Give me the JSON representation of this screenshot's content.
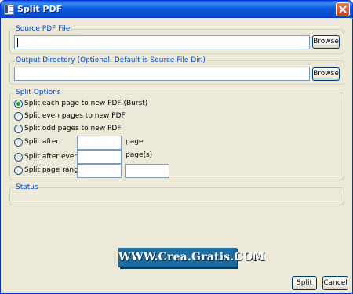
{
  "window": {
    "title": "Split PDF"
  },
  "source": {
    "label": "Source PDF File",
    "value": "",
    "browse_label": "Browse"
  },
  "output": {
    "label": "Output Directory (Optional. Default is Source File Dir.)",
    "value": "",
    "browse_label": "Browse"
  },
  "split_options": {
    "label": "Split Options",
    "selected": "burst",
    "options": [
      {
        "id": "burst",
        "label": "Split each page to new PDF (Burst)"
      },
      {
        "id": "even",
        "label": "Split even pages to new PDF"
      },
      {
        "id": "odd",
        "label": "Split odd pages to new PDF"
      },
      {
        "id": "after",
        "label": "Split after",
        "unit": "page",
        "value": ""
      },
      {
        "id": "every",
        "label": "Split after every",
        "unit": "page(s)",
        "value": ""
      },
      {
        "id": "range",
        "label": "Split page range",
        "from": "",
        "to": ""
      }
    ]
  },
  "status": {
    "label": "Status"
  },
  "watermark": {
    "text": "WWW.Crea.Gratis.COM"
  },
  "footer": {
    "split_label": "Split",
    "cancel_label": "Cancel"
  },
  "colors": {
    "title_bar": "#0a4fd1",
    "group_label": "#0046d5",
    "window_bg": "#ece9d8",
    "watermark_bg": "#1c6ca0"
  }
}
